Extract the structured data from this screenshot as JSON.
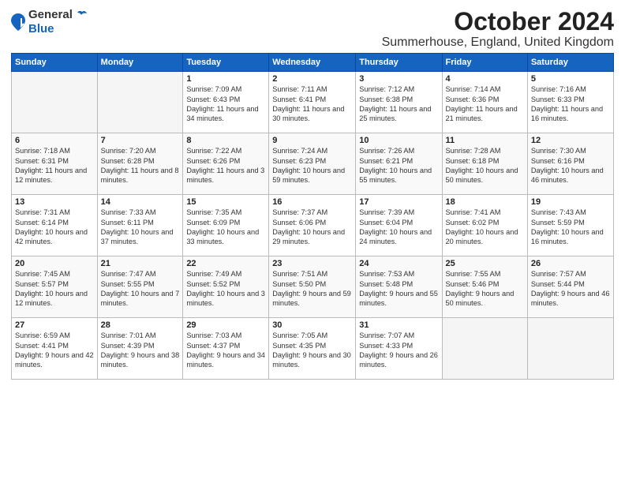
{
  "logo": {
    "general": "General",
    "blue": "Blue"
  },
  "title": "October 2024",
  "location": "Summerhouse, England, United Kingdom",
  "days_of_week": [
    "Sunday",
    "Monday",
    "Tuesday",
    "Wednesday",
    "Thursday",
    "Friday",
    "Saturday"
  ],
  "weeks": [
    [
      {
        "day": "",
        "info": ""
      },
      {
        "day": "",
        "info": ""
      },
      {
        "day": "1",
        "info": "Sunrise: 7:09 AM\nSunset: 6:43 PM\nDaylight: 11 hours\nand 34 minutes."
      },
      {
        "day": "2",
        "info": "Sunrise: 7:11 AM\nSunset: 6:41 PM\nDaylight: 11 hours\nand 30 minutes."
      },
      {
        "day": "3",
        "info": "Sunrise: 7:12 AM\nSunset: 6:38 PM\nDaylight: 11 hours\nand 25 minutes."
      },
      {
        "day": "4",
        "info": "Sunrise: 7:14 AM\nSunset: 6:36 PM\nDaylight: 11 hours\nand 21 minutes."
      },
      {
        "day": "5",
        "info": "Sunrise: 7:16 AM\nSunset: 6:33 PM\nDaylight: 11 hours\nand 16 minutes."
      }
    ],
    [
      {
        "day": "6",
        "info": "Sunrise: 7:18 AM\nSunset: 6:31 PM\nDaylight: 11 hours\nand 12 minutes."
      },
      {
        "day": "7",
        "info": "Sunrise: 7:20 AM\nSunset: 6:28 PM\nDaylight: 11 hours\nand 8 minutes."
      },
      {
        "day": "8",
        "info": "Sunrise: 7:22 AM\nSunset: 6:26 PM\nDaylight: 11 hours\nand 3 minutes."
      },
      {
        "day": "9",
        "info": "Sunrise: 7:24 AM\nSunset: 6:23 PM\nDaylight: 10 hours\nand 59 minutes."
      },
      {
        "day": "10",
        "info": "Sunrise: 7:26 AM\nSunset: 6:21 PM\nDaylight: 10 hours\nand 55 minutes."
      },
      {
        "day": "11",
        "info": "Sunrise: 7:28 AM\nSunset: 6:18 PM\nDaylight: 10 hours\nand 50 minutes."
      },
      {
        "day": "12",
        "info": "Sunrise: 7:30 AM\nSunset: 6:16 PM\nDaylight: 10 hours\nand 46 minutes."
      }
    ],
    [
      {
        "day": "13",
        "info": "Sunrise: 7:31 AM\nSunset: 6:14 PM\nDaylight: 10 hours\nand 42 minutes."
      },
      {
        "day": "14",
        "info": "Sunrise: 7:33 AM\nSunset: 6:11 PM\nDaylight: 10 hours\nand 37 minutes."
      },
      {
        "day": "15",
        "info": "Sunrise: 7:35 AM\nSunset: 6:09 PM\nDaylight: 10 hours\nand 33 minutes."
      },
      {
        "day": "16",
        "info": "Sunrise: 7:37 AM\nSunset: 6:06 PM\nDaylight: 10 hours\nand 29 minutes."
      },
      {
        "day": "17",
        "info": "Sunrise: 7:39 AM\nSunset: 6:04 PM\nDaylight: 10 hours\nand 24 minutes."
      },
      {
        "day": "18",
        "info": "Sunrise: 7:41 AM\nSunset: 6:02 PM\nDaylight: 10 hours\nand 20 minutes."
      },
      {
        "day": "19",
        "info": "Sunrise: 7:43 AM\nSunset: 5:59 PM\nDaylight: 10 hours\nand 16 minutes."
      }
    ],
    [
      {
        "day": "20",
        "info": "Sunrise: 7:45 AM\nSunset: 5:57 PM\nDaylight: 10 hours\nand 12 minutes."
      },
      {
        "day": "21",
        "info": "Sunrise: 7:47 AM\nSunset: 5:55 PM\nDaylight: 10 hours\nand 7 minutes."
      },
      {
        "day": "22",
        "info": "Sunrise: 7:49 AM\nSunset: 5:52 PM\nDaylight: 10 hours\nand 3 minutes."
      },
      {
        "day": "23",
        "info": "Sunrise: 7:51 AM\nSunset: 5:50 PM\nDaylight: 9 hours\nand 59 minutes."
      },
      {
        "day": "24",
        "info": "Sunrise: 7:53 AM\nSunset: 5:48 PM\nDaylight: 9 hours\nand 55 minutes."
      },
      {
        "day": "25",
        "info": "Sunrise: 7:55 AM\nSunset: 5:46 PM\nDaylight: 9 hours\nand 50 minutes."
      },
      {
        "day": "26",
        "info": "Sunrise: 7:57 AM\nSunset: 5:44 PM\nDaylight: 9 hours\nand 46 minutes."
      }
    ],
    [
      {
        "day": "27",
        "info": "Sunrise: 6:59 AM\nSunset: 4:41 PM\nDaylight: 9 hours\nand 42 minutes."
      },
      {
        "day": "28",
        "info": "Sunrise: 7:01 AM\nSunset: 4:39 PM\nDaylight: 9 hours\nand 38 minutes."
      },
      {
        "day": "29",
        "info": "Sunrise: 7:03 AM\nSunset: 4:37 PM\nDaylight: 9 hours\nand 34 minutes."
      },
      {
        "day": "30",
        "info": "Sunrise: 7:05 AM\nSunset: 4:35 PM\nDaylight: 9 hours\nand 30 minutes."
      },
      {
        "day": "31",
        "info": "Sunrise: 7:07 AM\nSunset: 4:33 PM\nDaylight: 9 hours\nand 26 minutes."
      },
      {
        "day": "",
        "info": ""
      },
      {
        "day": "",
        "info": ""
      }
    ]
  ]
}
